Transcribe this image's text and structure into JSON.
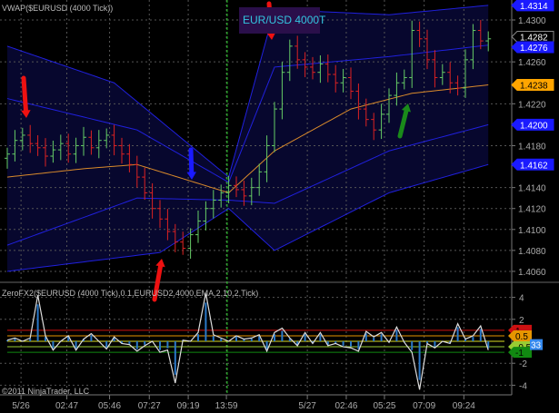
{
  "chart_data": {
    "type": "line",
    "price_panel": {
      "title": "VWAP($EURUSD (4000 Tick))",
      "instrument_label": "EUR/USD 4000T",
      "ylim": [
        1.4052,
        1.4318
      ],
      "yticks": [
        "1.4300",
        "1.4260",
        "1.4220",
        "1.4180",
        "1.4140",
        "1.4120",
        "1.4100",
        "1.4080",
        "1.4060"
      ],
      "closes": [
        1.4172,
        1.4185,
        1.419,
        1.4182,
        1.4178,
        1.417,
        1.4176,
        1.4182,
        1.4172,
        1.418,
        1.4188,
        1.4178,
        1.4185,
        1.419,
        1.418,
        1.4172,
        1.4162,
        1.415,
        1.4135,
        1.412,
        1.411,
        1.4098,
        1.4088,
        1.4082,
        1.4095,
        1.4108,
        1.412,
        1.4128,
        1.4135,
        1.4142,
        1.4138,
        1.4132,
        1.414,
        1.4155,
        1.418,
        1.4215,
        1.425,
        1.4275,
        1.4262,
        1.4255,
        1.425,
        1.4258,
        1.4248,
        1.424,
        1.4245,
        1.4232,
        1.4215,
        1.4205,
        1.4195,
        1.421,
        1.4228,
        1.424,
        1.4245,
        1.429,
        1.4282,
        1.4262,
        1.4245,
        1.425,
        1.424,
        1.4235,
        1.4262,
        1.429,
        1.428,
        1.4282
      ],
      "vwap": [
        [
          0,
          1.415
        ],
        [
          10,
          1.4158
        ],
        [
          17,
          1.4162
        ],
        [
          29,
          1.4135
        ],
        [
          35,
          1.4175
        ],
        [
          45,
          1.4215
        ],
        [
          53,
          1.423
        ],
        [
          63,
          1.4238
        ]
      ],
      "upper_outer": [
        [
          0,
          1.4275
        ],
        [
          14,
          1.424
        ],
        [
          29,
          1.415
        ],
        [
          35,
          1.431
        ],
        [
          50,
          1.4305
        ],
        [
          63,
          1.4314
        ]
      ],
      "upper_inner": [
        [
          0,
          1.4225
        ],
        [
          17,
          1.4195
        ],
        [
          29,
          1.4145
        ],
        [
          35,
          1.4255
        ],
        [
          50,
          1.4265
        ],
        [
          63,
          1.4276
        ]
      ],
      "lower_inner": [
        [
          0,
          1.4085
        ],
        [
          17,
          1.413
        ],
        [
          29,
          1.4128
        ],
        [
          35,
          1.4125
        ],
        [
          50,
          1.4175
        ],
        [
          63,
          1.42
        ]
      ],
      "lower_outer": [
        [
          0,
          1.406
        ],
        [
          20,
          1.4078
        ],
        [
          29,
          1.412
        ],
        [
          35,
          1.408
        ],
        [
          50,
          1.4135
        ],
        [
          63,
          1.4162
        ]
      ],
      "price_labels": [
        {
          "text": "1.4314",
          "value": 1.4314,
          "color": "#1a1aff"
        },
        {
          "text": "1.4282",
          "value": 1.4284,
          "color": "#000000"
        },
        {
          "text": "1.4276",
          "value": 1.4274,
          "color": "#1a1aff"
        },
        {
          "text": "1.4238",
          "value": 1.4238,
          "color": "#ffa500"
        },
        {
          "text": "1.4200",
          "value": 1.42,
          "color": "#1a1aff"
        },
        {
          "text": "1.4162",
          "value": 1.4162,
          "color": "#1a1aff"
        }
      ]
    },
    "indicator_panel": {
      "title": "ZeroFX2($EURUSD (4000 Tick),0.1,EURUSD2,4000,EMA,2,10,2,Tick)",
      "ylim": [
        -4.8,
        4.8
      ],
      "yticks": [
        "4",
        "2",
        "-2",
        "-4"
      ],
      "values": [
        0.1,
        0.3,
        0.0,
        0.3,
        4.2,
        0.5,
        -0.8,
        0.0,
        0.5,
        -0.8,
        0.2,
        0.7,
        0.0,
        -0.7,
        0.4,
        -0.2,
        -0.3,
        -0.9,
        -0.4,
        0.0,
        -1.0,
        -0.8,
        -3.8,
        0.1,
        0.0,
        0.8,
        4.4,
        0.6,
        0.3,
        0.0,
        0.5,
        0.2,
        0.3,
        0.6,
        -0.9,
        0.8,
        1.2,
        0.3,
        -0.4,
        0.8,
        -0.2,
        0.8,
        -0.4,
        -0.2,
        -0.5,
        -0.6,
        -0.9,
        0.9,
        0.4,
        0.8,
        -0.1,
        1.3,
        -0.1,
        -1.0,
        -4.4,
        -0.2,
        -0.6,
        0.0,
        -0.2,
        1.6,
        0.2,
        0.5,
        1.4,
        -0.8
      ],
      "levels": [
        {
          "text": "1",
          "value": 1,
          "color": "#cc1111"
        },
        {
          "text": "0.5",
          "value": 0.5,
          "color": "#e69500"
        },
        {
          "text": "-0.5",
          "value": -0.5,
          "color": "#99cc33"
        },
        {
          "text": "-1",
          "value": -1,
          "color": "#118811"
        }
      ],
      "last_value_label": "33"
    },
    "x_labels": [
      {
        "text": "5/26",
        "bar": 1.8
      },
      {
        "text": "02:47",
        "bar": 7.8
      },
      {
        "text": "05:46",
        "bar": 13.4
      },
      {
        "text": "07:27",
        "bar": 18.6
      },
      {
        "text": "09:19",
        "bar": 23.7
      },
      {
        "text": "13:59",
        "bar": 28.7
      },
      {
        "text": "5/27",
        "bar": 39.3
      },
      {
        "text": "02:46",
        "bar": 44.4
      },
      {
        "text": "05:25",
        "bar": 49.4
      },
      {
        "text": "07:09",
        "bar": 54.6
      },
      {
        "text": "09:24",
        "bar": 59.8
      }
    ],
    "session_break_bar": 28.8
  },
  "copyright": "©2011 NinjaTrader, LLC",
  "colors": {
    "up": "#66cc66",
    "down": "#dd2222",
    "vwap": "#d98a2b",
    "band": "#2020dd",
    "fill": "#07072e",
    "grid": "#555555"
  }
}
